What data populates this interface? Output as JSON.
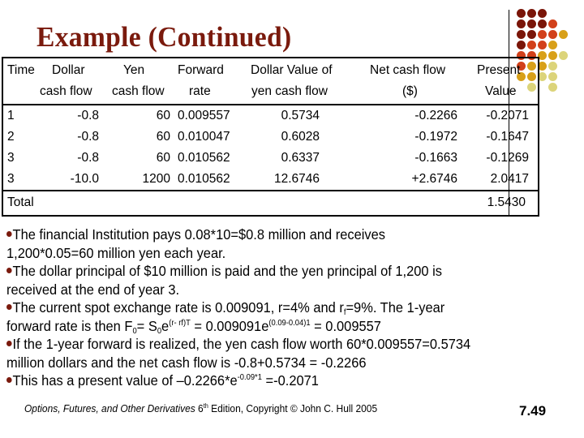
{
  "title": "Example (Continued)",
  "decoration": {
    "dot_colors": {
      "dark_red": "#7a1508",
      "red_orange": "#d2401a",
      "gold": "#d8a019",
      "pale": "#dcd47a"
    }
  },
  "table": {
    "headers": [
      {
        "line1": "Time",
        "line2": ""
      },
      {
        "line1": "Dollar",
        "line2": "cash flow"
      },
      {
        "line1": "Yen",
        "line2": "cash flow"
      },
      {
        "line1": "Forward",
        "line2": "rate"
      },
      {
        "line1": "Dollar Value of",
        "line2": "yen cash flow"
      },
      {
        "line1": "Net cash flow",
        "line2": "($)"
      },
      {
        "line1": "Present",
        "line2": "Value"
      }
    ],
    "rows": [
      [
        "1",
        "-0.8",
        "60",
        "0.009557",
        "0.5734",
        "-0.2266",
        "-0.2071"
      ],
      [
        "2",
        "-0.8",
        "60",
        "0.010047",
        "0.6028",
        "-0.1972",
        "-0.1647"
      ],
      [
        "3",
        "-0.8",
        "60",
        "0.010562",
        "0.6337",
        "-0.1663",
        "-0.1269"
      ],
      [
        "3",
        "-10.0",
        "1200",
        "0.010562",
        "12.6746",
        "+2.6746",
        "2.0417"
      ]
    ],
    "total_label": "Total",
    "total_value": "1.5430"
  },
  "bullets": {
    "b1_line1": "The financial Institution pays 0.08*10=$0.8 million and receives",
    "b1_line2": "1,200*0.05=60 million yen each year.",
    "b2_line1": "The dollar principal of $10 million is paid and the yen principal of 1,200 is",
    "b2_line2": "received at the end of year 3.",
    "b3_a": "The current spot exchange rate is 0.009091, r=4% and r",
    "b3_sub_f": "f",
    "b3_b": "=9%. The 1-year",
    "b3_c": "forward rate is then F",
    "b3_sub_0a": "0",
    "b3_d": "= S",
    "b3_sub_0b": "0",
    "b3_e": "e",
    "b3_sup1": "(r- rf)T",
    "b3_f": " = 0.009091e",
    "b3_sup2": "(0.09-0.04)1",
    "b3_g": " = 0.009557",
    "b4_line1": "If the 1-year forward is realized, the yen cash flow worth 60*0.009557=0.5734",
    "b4_line2": "million dollars and the net cash flow is -0.8+0.5734 = -0.2266",
    "b5_a": "This has a present value of –0.2266*e",
    "b5_sup": "-0.09*1",
    "b5_b": " =-0.2071"
  },
  "footer": {
    "book": "Options, Futures, and Other Derivatives",
    "edition_num": " 6",
    "edition_sup": "th",
    "rest": " Edition, Copyright © John C. Hull 2005",
    "slide_number": "7.49"
  }
}
